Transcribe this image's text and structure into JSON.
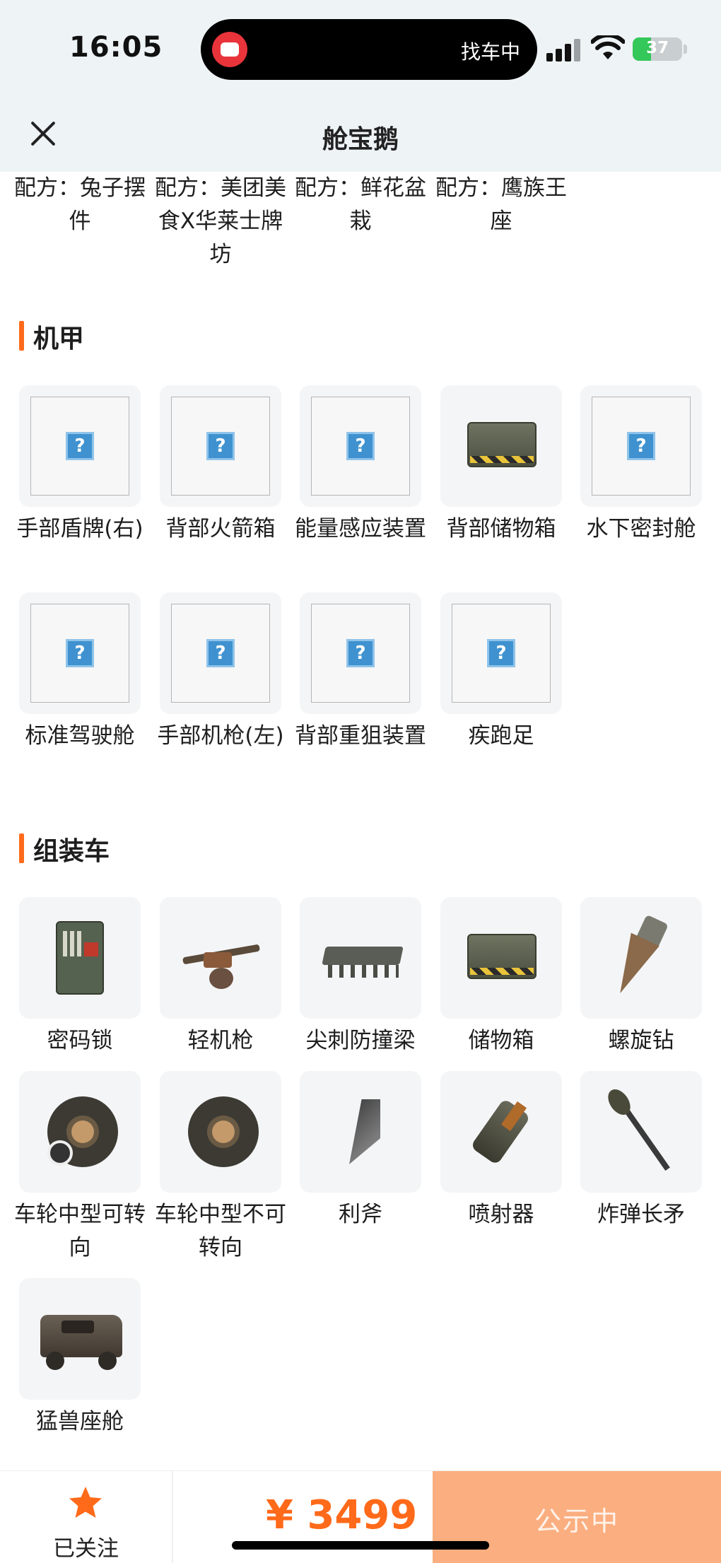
{
  "status_bar": {
    "time": "16:05",
    "island_text": "找车中",
    "battery_level": 37,
    "battery_text": "37"
  },
  "header": {
    "title": "舱宝鹅",
    "close_icon": "close-icon"
  },
  "recipes": [
    {
      "label": "配方：兔子摆件"
    },
    {
      "label": "配方：美团美食X华莱士牌坊"
    },
    {
      "label": "配方：鲜花盆栽"
    },
    {
      "label": "配方：鹰族王座"
    }
  ],
  "sections": [
    {
      "title": "机甲",
      "items": [
        {
          "label": "手部盾牌(右)",
          "image": "broken-image-icon"
        },
        {
          "label": "背部火箭箱",
          "image": "broken-image-icon"
        },
        {
          "label": "能量感应装置",
          "image": "broken-image-icon"
        },
        {
          "label": "背部储物箱",
          "image": "storage-box-icon"
        },
        {
          "label": "水下密封舱",
          "image": "broken-image-icon"
        },
        {
          "label": "标准驾驶舱",
          "image": "broken-image-icon"
        },
        {
          "label": "手部机枪(左)",
          "image": "broken-image-icon"
        },
        {
          "label": "背部重狙装置",
          "image": "broken-image-icon"
        },
        {
          "label": "疾跑足",
          "image": "broken-image-icon"
        }
      ]
    },
    {
      "title": "组装车",
      "items": [
        {
          "label": "密码锁",
          "image": "keypad-lock-icon"
        },
        {
          "label": "轻机枪",
          "image": "light-machine-gun-icon"
        },
        {
          "label": "尖刺防撞梁",
          "image": "spiked-bumper-icon"
        },
        {
          "label": "储物箱",
          "image": "storage-box-icon"
        },
        {
          "label": "螺旋钻",
          "image": "drill-icon"
        },
        {
          "label": "车轮中型可转向",
          "image": "wheel-icon"
        },
        {
          "label": "车轮中型不可转向",
          "image": "wheel-icon"
        },
        {
          "label": "利斧",
          "image": "axe-blade-icon"
        },
        {
          "label": "喷射器",
          "image": "thruster-icon"
        },
        {
          "label": "炸弹长矛",
          "image": "bomb-spear-icon"
        },
        {
          "label": "猛兽座舱",
          "image": "beast-cockpit-icon"
        }
      ]
    }
  ],
  "bottom_bar": {
    "follow_label": "已关注",
    "price": "¥ 3499",
    "status_label": "公示中",
    "accent_color": "#ff6a1a",
    "button_color": "#fbae7f"
  }
}
